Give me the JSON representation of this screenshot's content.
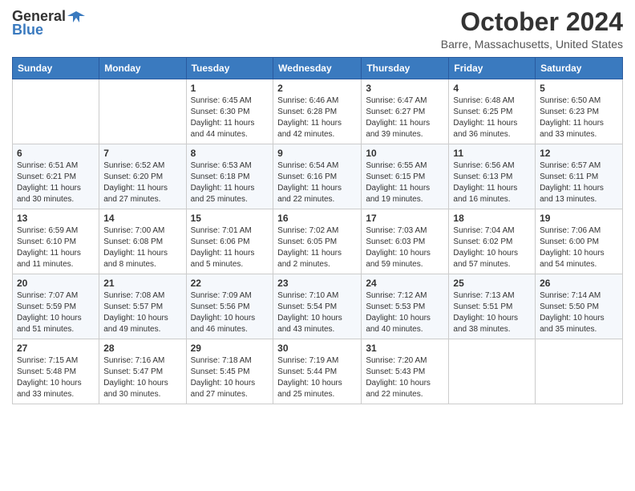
{
  "logo": {
    "general": "General",
    "blue": "Blue"
  },
  "header": {
    "month": "October 2024",
    "location": "Barre, Massachusetts, United States"
  },
  "weekdays": [
    "Sunday",
    "Monday",
    "Tuesday",
    "Wednesday",
    "Thursday",
    "Friday",
    "Saturday"
  ],
  "weeks": [
    [
      {
        "day": "",
        "info": ""
      },
      {
        "day": "",
        "info": ""
      },
      {
        "day": "1",
        "info": "Sunrise: 6:45 AM\nSunset: 6:30 PM\nDaylight: 11 hours and 44 minutes."
      },
      {
        "day": "2",
        "info": "Sunrise: 6:46 AM\nSunset: 6:28 PM\nDaylight: 11 hours and 42 minutes."
      },
      {
        "day": "3",
        "info": "Sunrise: 6:47 AM\nSunset: 6:27 PM\nDaylight: 11 hours and 39 minutes."
      },
      {
        "day": "4",
        "info": "Sunrise: 6:48 AM\nSunset: 6:25 PM\nDaylight: 11 hours and 36 minutes."
      },
      {
        "day": "5",
        "info": "Sunrise: 6:50 AM\nSunset: 6:23 PM\nDaylight: 11 hours and 33 minutes."
      }
    ],
    [
      {
        "day": "6",
        "info": "Sunrise: 6:51 AM\nSunset: 6:21 PM\nDaylight: 11 hours and 30 minutes."
      },
      {
        "day": "7",
        "info": "Sunrise: 6:52 AM\nSunset: 6:20 PM\nDaylight: 11 hours and 27 minutes."
      },
      {
        "day": "8",
        "info": "Sunrise: 6:53 AM\nSunset: 6:18 PM\nDaylight: 11 hours and 25 minutes."
      },
      {
        "day": "9",
        "info": "Sunrise: 6:54 AM\nSunset: 6:16 PM\nDaylight: 11 hours and 22 minutes."
      },
      {
        "day": "10",
        "info": "Sunrise: 6:55 AM\nSunset: 6:15 PM\nDaylight: 11 hours and 19 minutes."
      },
      {
        "day": "11",
        "info": "Sunrise: 6:56 AM\nSunset: 6:13 PM\nDaylight: 11 hours and 16 minutes."
      },
      {
        "day": "12",
        "info": "Sunrise: 6:57 AM\nSunset: 6:11 PM\nDaylight: 11 hours and 13 minutes."
      }
    ],
    [
      {
        "day": "13",
        "info": "Sunrise: 6:59 AM\nSunset: 6:10 PM\nDaylight: 11 hours and 11 minutes."
      },
      {
        "day": "14",
        "info": "Sunrise: 7:00 AM\nSunset: 6:08 PM\nDaylight: 11 hours and 8 minutes."
      },
      {
        "day": "15",
        "info": "Sunrise: 7:01 AM\nSunset: 6:06 PM\nDaylight: 11 hours and 5 minutes."
      },
      {
        "day": "16",
        "info": "Sunrise: 7:02 AM\nSunset: 6:05 PM\nDaylight: 11 hours and 2 minutes."
      },
      {
        "day": "17",
        "info": "Sunrise: 7:03 AM\nSunset: 6:03 PM\nDaylight: 10 hours and 59 minutes."
      },
      {
        "day": "18",
        "info": "Sunrise: 7:04 AM\nSunset: 6:02 PM\nDaylight: 10 hours and 57 minutes."
      },
      {
        "day": "19",
        "info": "Sunrise: 7:06 AM\nSunset: 6:00 PM\nDaylight: 10 hours and 54 minutes."
      }
    ],
    [
      {
        "day": "20",
        "info": "Sunrise: 7:07 AM\nSunset: 5:59 PM\nDaylight: 10 hours and 51 minutes."
      },
      {
        "day": "21",
        "info": "Sunrise: 7:08 AM\nSunset: 5:57 PM\nDaylight: 10 hours and 49 minutes."
      },
      {
        "day": "22",
        "info": "Sunrise: 7:09 AM\nSunset: 5:56 PM\nDaylight: 10 hours and 46 minutes."
      },
      {
        "day": "23",
        "info": "Sunrise: 7:10 AM\nSunset: 5:54 PM\nDaylight: 10 hours and 43 minutes."
      },
      {
        "day": "24",
        "info": "Sunrise: 7:12 AM\nSunset: 5:53 PM\nDaylight: 10 hours and 40 minutes."
      },
      {
        "day": "25",
        "info": "Sunrise: 7:13 AM\nSunset: 5:51 PM\nDaylight: 10 hours and 38 minutes."
      },
      {
        "day": "26",
        "info": "Sunrise: 7:14 AM\nSunset: 5:50 PM\nDaylight: 10 hours and 35 minutes."
      }
    ],
    [
      {
        "day": "27",
        "info": "Sunrise: 7:15 AM\nSunset: 5:48 PM\nDaylight: 10 hours and 33 minutes."
      },
      {
        "day": "28",
        "info": "Sunrise: 7:16 AM\nSunset: 5:47 PM\nDaylight: 10 hours and 30 minutes."
      },
      {
        "day": "29",
        "info": "Sunrise: 7:18 AM\nSunset: 5:45 PM\nDaylight: 10 hours and 27 minutes."
      },
      {
        "day": "30",
        "info": "Sunrise: 7:19 AM\nSunset: 5:44 PM\nDaylight: 10 hours and 25 minutes."
      },
      {
        "day": "31",
        "info": "Sunrise: 7:20 AM\nSunset: 5:43 PM\nDaylight: 10 hours and 22 minutes."
      },
      {
        "day": "",
        "info": ""
      },
      {
        "day": "",
        "info": ""
      }
    ]
  ]
}
